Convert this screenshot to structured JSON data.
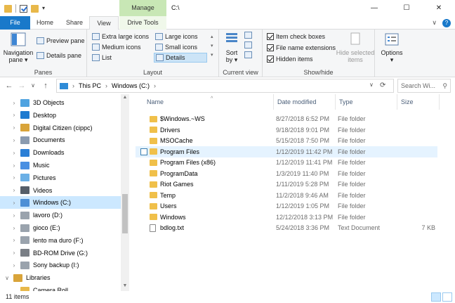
{
  "window": {
    "title": "C:\\",
    "context_tab": "Manage",
    "controls": {
      "minimize": "—",
      "maximize": "☐",
      "close": "✕"
    }
  },
  "tabs": {
    "file": "File",
    "home": "Home",
    "share": "Share",
    "view": "View",
    "drive_tools": "Drive Tools",
    "expand_icon": "∨",
    "help_icon": "?"
  },
  "ribbon": {
    "panes": {
      "label": "Panes",
      "navigation_pane": "Navigation",
      "navigation_pane_2": "pane ▾",
      "preview_pane": "Preview pane",
      "details_pane": "Details pane"
    },
    "layout": {
      "label": "Layout",
      "extra_large": "Extra large icons",
      "large": "Large icons",
      "medium": "Medium icons",
      "small": "Small icons",
      "list": "List",
      "details": "Details",
      "selected": "Details"
    },
    "current_view": {
      "label": "Current view",
      "sort_by": "Sort",
      "sort_by_2": "by ▾"
    },
    "show_hide": {
      "label": "Show/hide",
      "item_check_boxes": "Item check boxes",
      "file_name_extensions": "File name extensions",
      "hidden_items": "Hidden items",
      "hide_selected_1": "Hide selected",
      "hide_selected_2": "items",
      "checked": {
        "item_check_boxes": true,
        "file_name_extensions": true,
        "hidden_items": true
      }
    },
    "options": {
      "label": "Options",
      "arrow": "▾"
    }
  },
  "address": {
    "back": "←",
    "forward": "→",
    "recent": "∨",
    "up": "↑",
    "crumbs": [
      "This PC",
      "Windows (C:)"
    ],
    "separator": "›",
    "dropdown": "∨",
    "refresh": "⟳",
    "search_placeholder": "Search Wi...",
    "search_icon": "⚲"
  },
  "nav": {
    "items": [
      {
        "label": "3D Objects",
        "icon": "cube-icon",
        "color": "#4fa3e0",
        "expand": "›"
      },
      {
        "label": "Desktop",
        "icon": "desktop-icon",
        "color": "#1e7bd0",
        "expand": "›"
      },
      {
        "label": "Digital Citizen (cippc)",
        "icon": "user-folder-icon",
        "color": "#d9a43a",
        "expand": "›"
      },
      {
        "label": "Documents",
        "icon": "documents-icon",
        "color": "#8a9bb0",
        "expand": "›"
      },
      {
        "label": "Downloads",
        "icon": "downloads-icon",
        "color": "#2b7fd6",
        "expand": "›"
      },
      {
        "label": "Music",
        "icon": "music-icon",
        "color": "#4a90e2",
        "expand": "›"
      },
      {
        "label": "Pictures",
        "icon": "pictures-icon",
        "color": "#6bb0e6",
        "expand": "›"
      },
      {
        "label": "Videos",
        "icon": "videos-icon",
        "color": "#555e6a",
        "expand": "›"
      },
      {
        "label": "Windows (C:)",
        "icon": "windows-drive-icon",
        "color": "#4d8fd6",
        "expand": "›",
        "selected": true
      },
      {
        "label": "lavoro (D:)",
        "icon": "drive-icon",
        "color": "#9aa3ad",
        "expand": "›"
      },
      {
        "label": "gioco (E:)",
        "icon": "drive-icon",
        "color": "#9aa3ad",
        "expand": "›"
      },
      {
        "label": "lento ma duro (F:)",
        "icon": "drive-icon",
        "color": "#9aa3ad",
        "expand": "›"
      },
      {
        "label": "BD-ROM Drive (G:)",
        "icon": "disc-drive-icon",
        "color": "#7a7f86",
        "expand": "›"
      },
      {
        "label": "Sony backup (I:)",
        "icon": "drive-icon",
        "color": "#9aa3ad",
        "expand": "›"
      },
      {
        "label": "Libraries",
        "icon": "libraries-icon",
        "color": "#d9a43a",
        "expand": "∨",
        "top": true
      },
      {
        "label": "Camera Roll",
        "icon": "folder-icon",
        "color": "#e8b84a",
        "expand": ""
      }
    ]
  },
  "files": {
    "columns": {
      "name": "Name",
      "date": "Date modified",
      "type": "Type",
      "size": "Size"
    },
    "sort_indicator": "^",
    "rows": [
      {
        "name": "$Windows.~WS",
        "date": "8/27/2018 6:52 PM",
        "type": "File folder",
        "size": ""
      },
      {
        "name": "Drivers",
        "date": "9/18/2018 9:01 PM",
        "type": "File folder",
        "size": ""
      },
      {
        "name": "MSOCache",
        "date": "5/15/2018 7:50 PM",
        "type": "File folder",
        "size": ""
      },
      {
        "name": "Program Files",
        "date": "1/12/2019 11:42 PM",
        "type": "File folder",
        "size": "",
        "hover": true
      },
      {
        "name": "Program Files (x86)",
        "date": "1/12/2019 11:41 PM",
        "type": "File folder",
        "size": ""
      },
      {
        "name": "ProgramData",
        "date": "1/3/2019 11:40 PM",
        "type": "File folder",
        "size": ""
      },
      {
        "name": "Riot Games",
        "date": "1/11/2019 5:28 PM",
        "type": "File folder",
        "size": ""
      },
      {
        "name": "Temp",
        "date": "11/2/2018 9:46 AM",
        "type": "File folder",
        "size": ""
      },
      {
        "name": "Users",
        "date": "1/12/2019 1:05 PM",
        "type": "File folder",
        "size": ""
      },
      {
        "name": "Windows",
        "date": "12/12/2018 3:13 PM",
        "type": "File folder",
        "size": ""
      },
      {
        "name": "bdlog.txt",
        "date": "5/24/2018 3:36 PM",
        "type": "Text Document",
        "size": "7 KB",
        "doc": true
      }
    ]
  },
  "status": {
    "count": "11 items"
  },
  "colors": {
    "accent": "#1979ca",
    "manage": "#c8e7b5",
    "selected": "#cce8ff",
    "hover": "#e5f3ff",
    "folder": "#f0c04a"
  }
}
